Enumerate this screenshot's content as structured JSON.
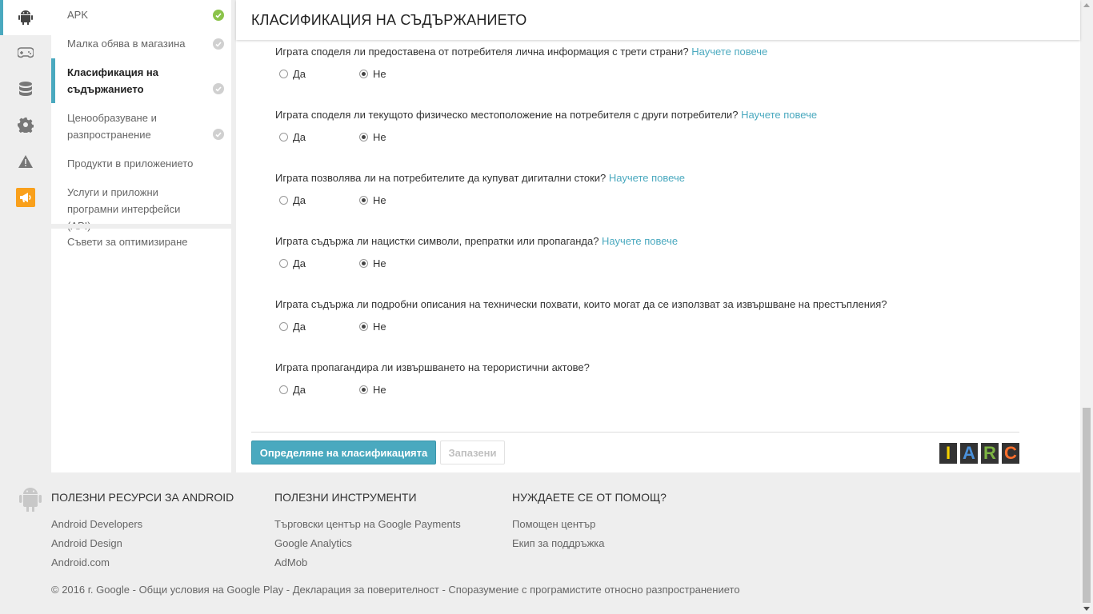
{
  "rail": {
    "items": [
      {
        "icon": "android-icon",
        "active": true
      },
      {
        "icon": "gamepad-icon",
        "active": false
      },
      {
        "icon": "database-icon",
        "active": false
      },
      {
        "icon": "gear-icon",
        "active": false
      },
      {
        "icon": "warning-icon",
        "active": false
      },
      {
        "icon": "megaphone-icon",
        "active": false
      }
    ]
  },
  "subnav": {
    "items": [
      {
        "label": "APK",
        "status": "complete"
      },
      {
        "label": "Малка обява в магазина",
        "status": "done"
      },
      {
        "label": "Класификация на съдържанието",
        "status": "done",
        "active": true
      },
      {
        "label": "Ценообразуване и разпространение",
        "status": "done"
      },
      {
        "label": "Продукти в приложението",
        "status": "none"
      },
      {
        "label": "Услуги и приложни програмни интерфейси (API)",
        "status": "none"
      }
    ],
    "optimization_tips": "Съвети за оптимизиране"
  },
  "main": {
    "title": "КЛАСИФИКАЦИЯ НА СЪДЪРЖАНИЕТО",
    "learn_more": "Научете повече",
    "yes_label": "Да",
    "no_label": "Не",
    "questions": [
      {
        "text": "Играта споделя ли предоставена от потребителя лична информация с трети страни?",
        "learn_more": "Научете повече",
        "answer": "no"
      },
      {
        "text": "Играта споделя ли текущото физическо местоположение на потребителя с други потребители?",
        "learn_more": "Научете повече",
        "answer": "no"
      },
      {
        "text": "Играта позволява ли на потребителите да купуват дигитални стоки?",
        "learn_more": "Научете повече",
        "answer": "no"
      },
      {
        "text": "Играта съдържа ли нацистки символи, препратки или пропаганда?",
        "learn_more": "Научете повече",
        "answer": "no"
      },
      {
        "text": "Играта съдържа ли подробни описания на технически похвати, които могат да се използват за извършване на престъпления?",
        "learn_more": "",
        "answer": "no"
      },
      {
        "text": "Играта пропагандира ли извършването на терористични актове?",
        "learn_more": "",
        "answer": "no"
      }
    ],
    "determine_button": "Определяне на класификацията",
    "saved_button": "Запазени",
    "iarc_letters": [
      "I",
      "A",
      "R",
      "C"
    ],
    "iarc_colors": [
      "#f5d000",
      "#4a90d9",
      "#7cb342",
      "#ff6f2c"
    ]
  },
  "footer": {
    "col1": {
      "title": "ПОЛЕЗНИ РЕСУРСИ ЗА ANDROID",
      "links": [
        "Android Developers",
        "Android Design",
        "Android.com"
      ]
    },
    "col2": {
      "title": "ПОЛЕЗНИ ИНСТРУМЕНТИ",
      "links": [
        "Търговски център на Google Payments",
        "Google Analytics",
        "AdMob"
      ]
    },
    "col3": {
      "title": "НУЖДАЕТЕ СЕ ОТ ПОМОЩ?",
      "links": [
        "Помощен център",
        "Екип за поддръжка"
      ]
    },
    "legal": "© 2016 г. Google - Общи условия на Google Play - Декларация за поверителност - Споразумение с програмистите относно разпространението"
  },
  "colors": {
    "accent": "#4aa9bf",
    "check_green": "#8bc34a",
    "check_grey": "#d0d0d0",
    "alert_orange": "#f9a01b"
  }
}
